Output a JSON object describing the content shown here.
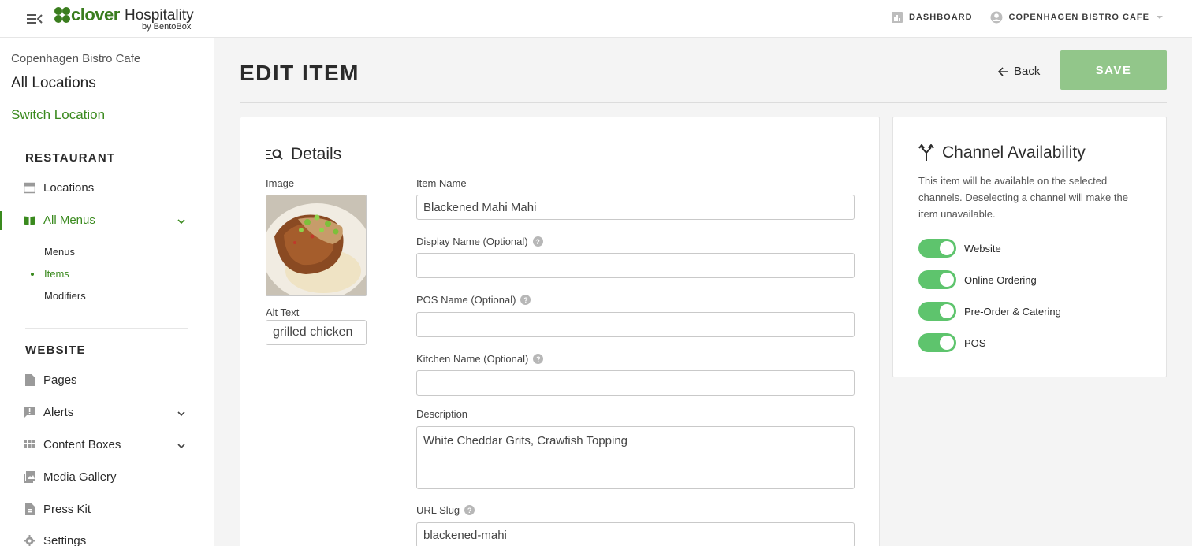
{
  "brand": {
    "name_bold": "clover",
    "name_rest": "Hospitality",
    "byline": "by BentoBox",
    "accent": "#3a8a1e"
  },
  "topbar": {
    "dashboard": "DASHBOARD",
    "account": "COPENHAGEN BISTRO CAFE"
  },
  "sidebar": {
    "location_name": "Copenhagen Bistro Cafe",
    "all_locations": "All Locations",
    "switch_location": "Switch Location",
    "restaurant_heading": "RESTAURANT",
    "locations": "Locations",
    "all_menus": "All Menus",
    "menus": "Menus",
    "items": "Items",
    "modifiers": "Modifiers",
    "website_heading": "WEBSITE",
    "pages": "Pages",
    "alerts": "Alerts",
    "content_boxes": "Content Boxes",
    "media_gallery": "Media Gallery",
    "press_kit": "Press Kit",
    "settings": "Settings"
  },
  "header": {
    "title": "EDIT ITEM",
    "back": "Back",
    "save": "SAVE"
  },
  "details": {
    "title": "Details",
    "image_label": "Image",
    "alt_text_label": "Alt Text",
    "alt_text_value": "grilled chicken",
    "item_name_label": "Item Name",
    "item_name_value": "Blackened Mahi Mahi",
    "display_name_label": "Display Name (Optional)",
    "display_name_value": "",
    "pos_name_label": "POS Name (Optional)",
    "pos_name_value": "",
    "kitchen_name_label": "Kitchen Name (Optional)",
    "kitchen_name_value": "",
    "description_label": "Description",
    "description_value": "White Cheddar Grits, Crawfish Topping",
    "url_slug_label": "URL Slug",
    "url_slug_value": "blackened-mahi"
  },
  "channels": {
    "title": "Channel Availability",
    "description": "This item will be available on the selected channels. Deselecting a channel will make the item unavailable.",
    "toggles": [
      {
        "label": "Website",
        "on": true
      },
      {
        "label": "Online Ordering",
        "on": true
      },
      {
        "label": "Pre-Order & Catering",
        "on": true
      },
      {
        "label": "POS",
        "on": true
      }
    ]
  }
}
